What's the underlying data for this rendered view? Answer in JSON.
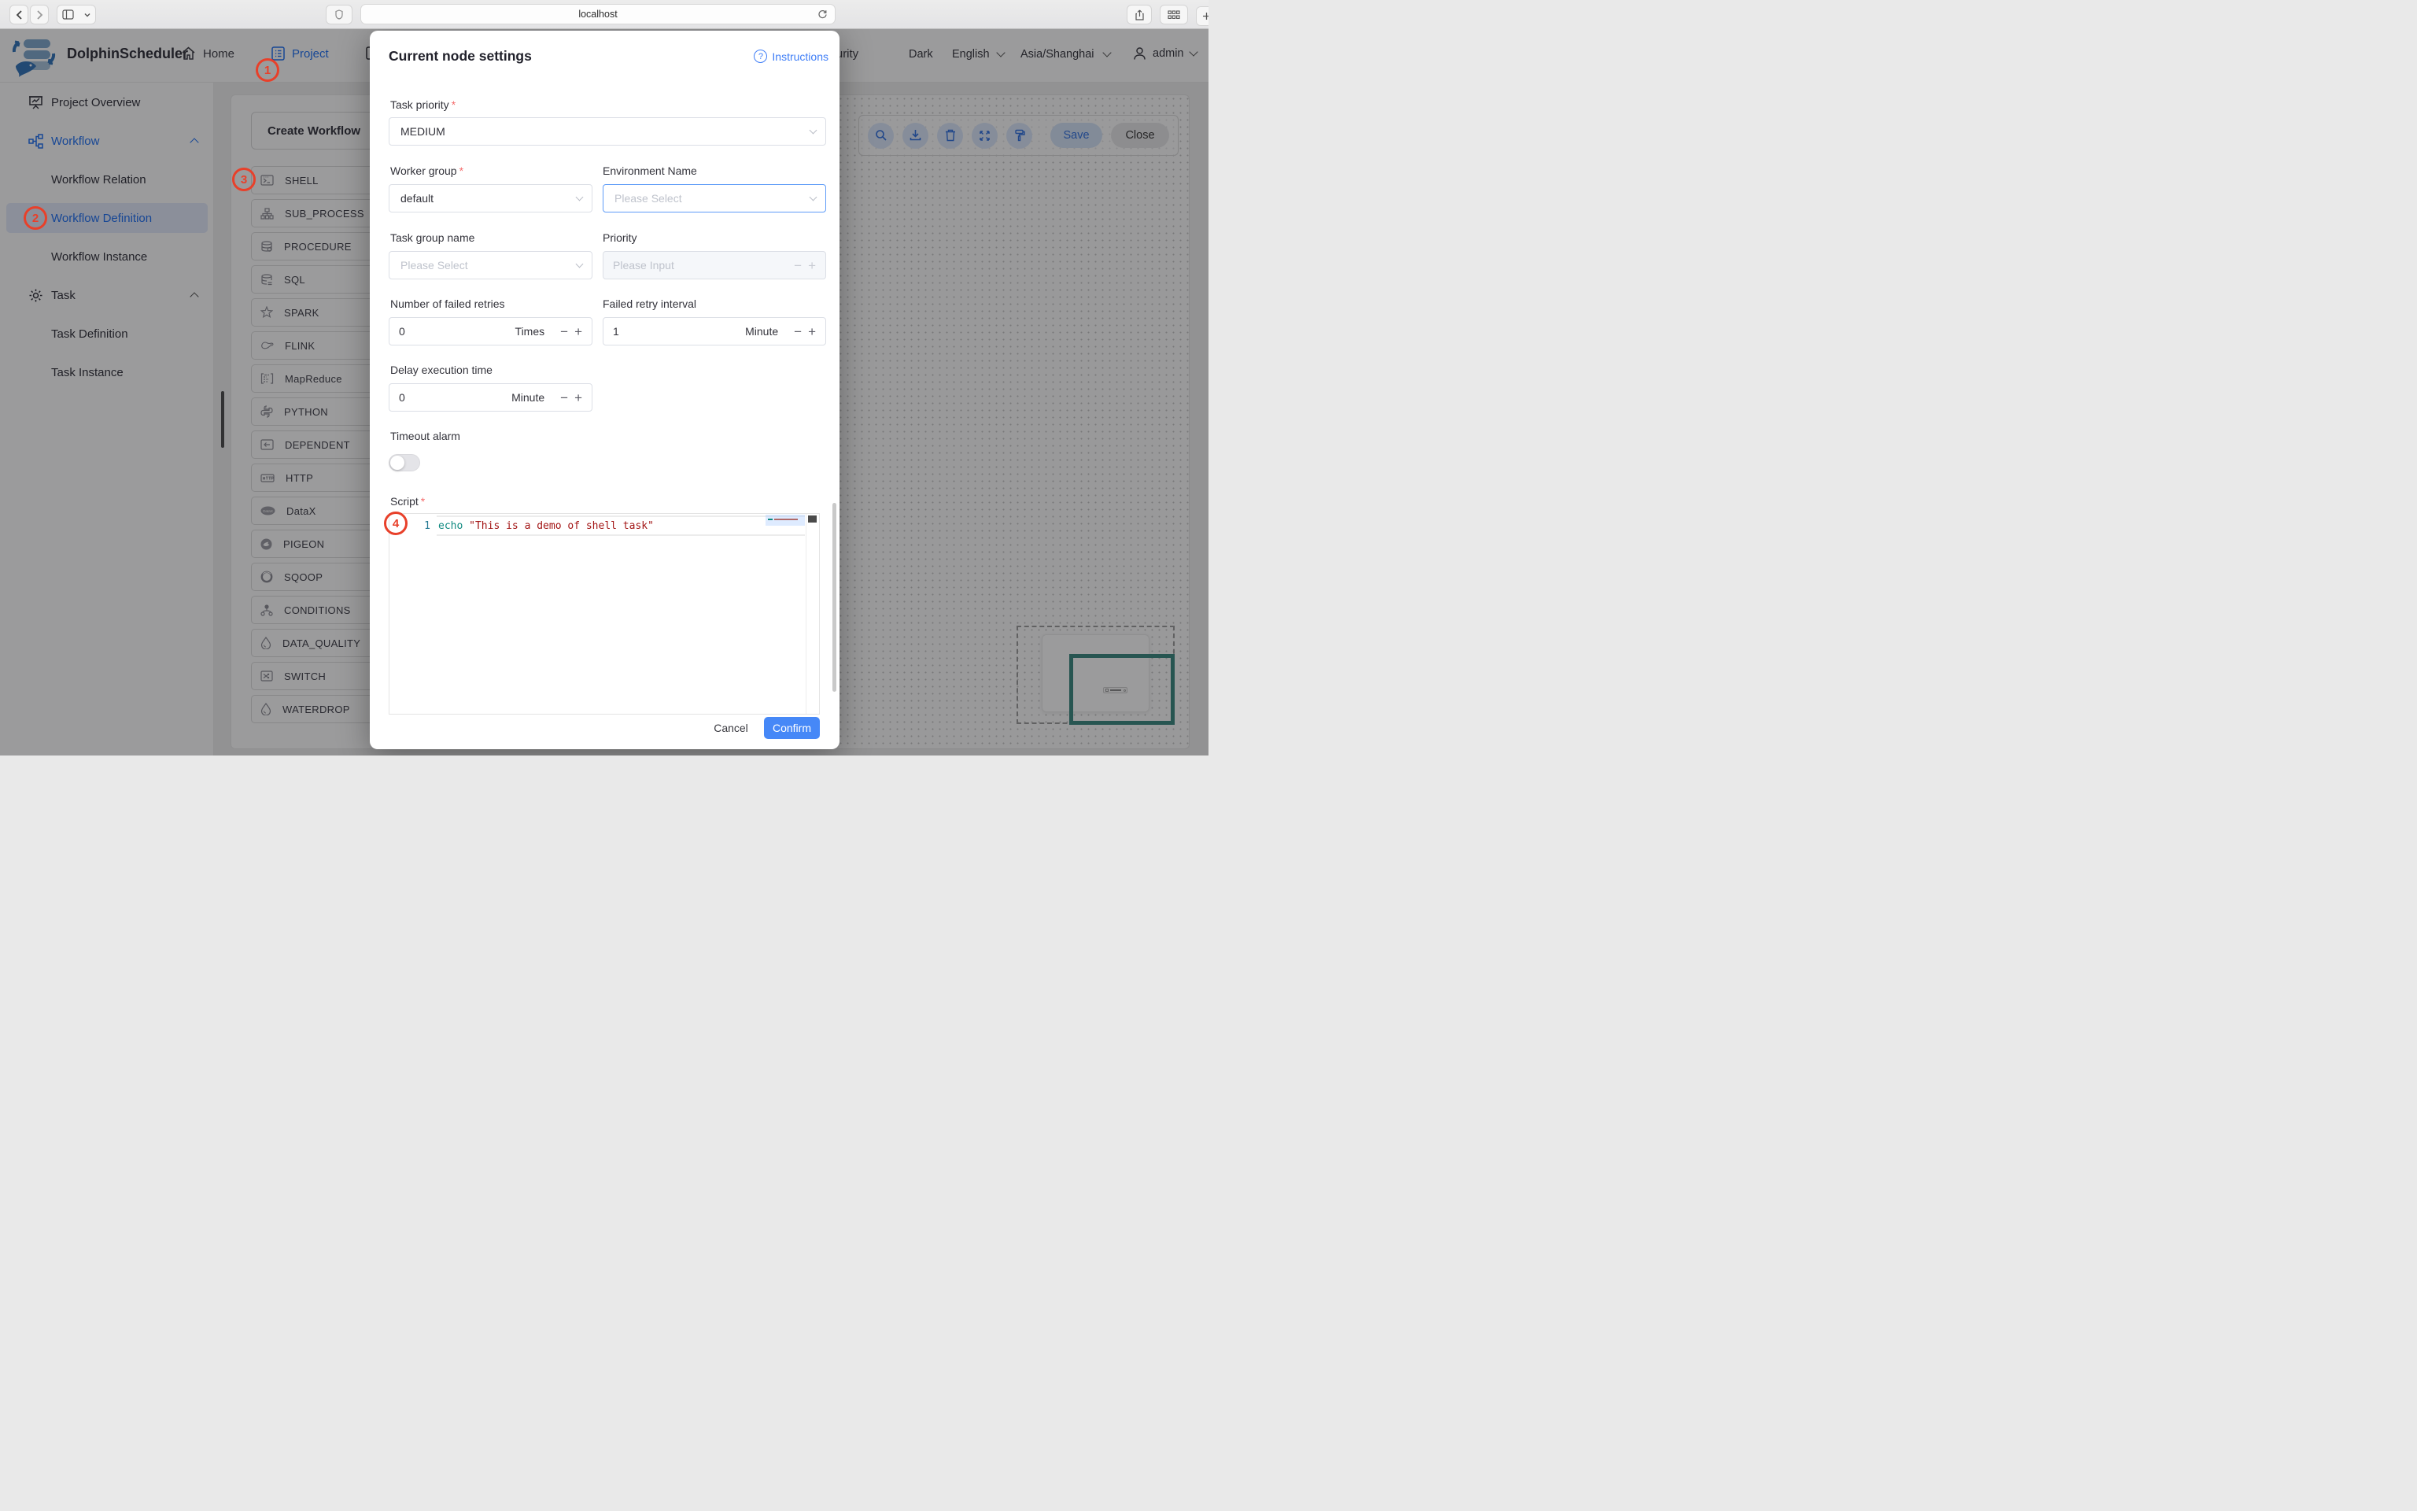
{
  "browser": {
    "url": "localhost"
  },
  "header": {
    "brand": "DolphinScheduler",
    "nav_home": "Home",
    "nav_project": "Project",
    "nav_security": "Security",
    "theme": "Dark",
    "language": "English",
    "timezone": "Asia/Shanghai",
    "user": "admin"
  },
  "sidebar": {
    "items": [
      {
        "label": "Project Overview"
      },
      {
        "label": "Workflow"
      },
      {
        "label": "Workflow Relation"
      },
      {
        "label": "Workflow Definition"
      },
      {
        "label": "Workflow Instance"
      },
      {
        "label": "Task"
      },
      {
        "label": "Task Definition"
      },
      {
        "label": "Task Instance"
      }
    ]
  },
  "task_panel": {
    "create_button": "Create Workflow",
    "types": [
      {
        "label": "SHELL"
      },
      {
        "label": "SUB_PROCESS"
      },
      {
        "label": "PROCEDURE"
      },
      {
        "label": "SQL"
      },
      {
        "label": "SPARK"
      },
      {
        "label": "FLINK"
      },
      {
        "label": "MapReduce"
      },
      {
        "label": "PYTHON"
      },
      {
        "label": "DEPENDENT"
      },
      {
        "label": "HTTP"
      },
      {
        "label": "DataX"
      },
      {
        "label": "PIGEON"
      },
      {
        "label": "SQOOP"
      },
      {
        "label": "CONDITIONS"
      },
      {
        "label": "DATA_QUALITY"
      },
      {
        "label": "SWITCH"
      },
      {
        "label": "WATERDROP"
      }
    ]
  },
  "canvas_toolbar": {
    "save": "Save",
    "close": "Close"
  },
  "modal": {
    "title": "Current node settings",
    "instructions": "Instructions",
    "required_mark": "*",
    "fields": {
      "task_priority": {
        "label": "Task priority",
        "value": "MEDIUM"
      },
      "worker_group": {
        "label": "Worker group",
        "value": "default"
      },
      "environment": {
        "label": "Environment Name",
        "placeholder": "Please Select"
      },
      "task_group": {
        "label": "Task group name",
        "placeholder": "Please Select"
      },
      "priority": {
        "label": "Priority",
        "placeholder": "Please Input"
      },
      "failed_retries": {
        "label": "Number of failed retries",
        "value": "0",
        "unit": "Times"
      },
      "retry_interval": {
        "label": "Failed retry interval",
        "value": "1",
        "unit": "Minute"
      },
      "delay_time": {
        "label": "Delay execution time",
        "value": "0",
        "unit": "Minute"
      },
      "timeout_alarm": {
        "label": "Timeout alarm",
        "enabled": false
      },
      "script": {
        "label": "Script",
        "line_number": "1",
        "code_keyword": "echo",
        "code_string": " \"This is a demo of shell task\""
      }
    },
    "cancel": "Cancel",
    "confirm": "Confirm"
  },
  "annotations": [
    {
      "n": "1"
    },
    {
      "n": "2"
    },
    {
      "n": "3"
    },
    {
      "n": "4"
    }
  ],
  "colors": {
    "accent": "#1d6ef3",
    "annotation_red": "#e8402a",
    "confirm_blue": "#4688f7",
    "selection_teal": "#38877f",
    "code_keyword": "#0f8a80",
    "code_string": "#a31515"
  }
}
